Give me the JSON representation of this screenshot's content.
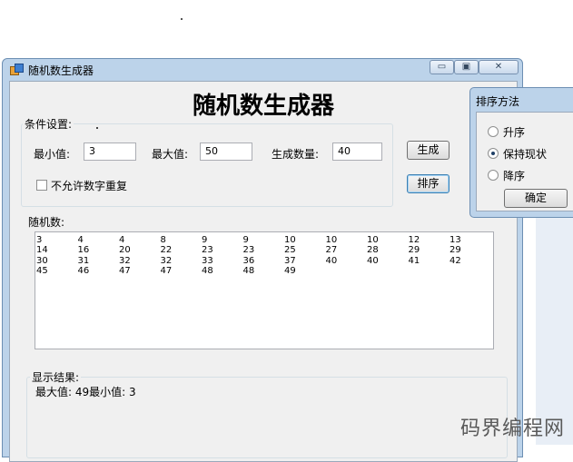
{
  "window": {
    "title": "随机数生成器",
    "minimize_glyph": "▭",
    "maximize_glyph": "▣",
    "close_glyph": "✕"
  },
  "heading": "随机数生成器",
  "settings": {
    "group_label": "条件设置:",
    "min_label": "最小值:",
    "min_value": "3",
    "max_label": "最大值:",
    "max_value": "50",
    "count_label": "生成数量:",
    "count_value": "40",
    "no_duplicate_label": "不允许数字重复",
    "no_duplicate_checked": false
  },
  "buttons": {
    "generate": "生成",
    "sort": "排序"
  },
  "random_numbers": {
    "label": "随机数:",
    "rows": [
      [
        "3",
        "4",
        "4",
        "8",
        "9",
        "9",
        "10",
        "10",
        "10",
        "12",
        "13"
      ],
      [
        "14",
        "16",
        "20",
        "22",
        "23",
        "23",
        "25",
        "27",
        "28",
        "29",
        "29"
      ],
      [
        "30",
        "31",
        "32",
        "32",
        "33",
        "36",
        "37",
        "40",
        "40",
        "41",
        "42"
      ],
      [
        "45",
        "46",
        "47",
        "47",
        "48",
        "48",
        "49"
      ]
    ]
  },
  "result": {
    "label": "显示结果:",
    "text": "最大值: 49最小值: 3"
  },
  "sort_dialog": {
    "title": "排序方法",
    "options": [
      "升序",
      "保持现状",
      "降序"
    ],
    "selected": "保持现状",
    "ok": "确定"
  },
  "watermark": "码界编程网"
}
